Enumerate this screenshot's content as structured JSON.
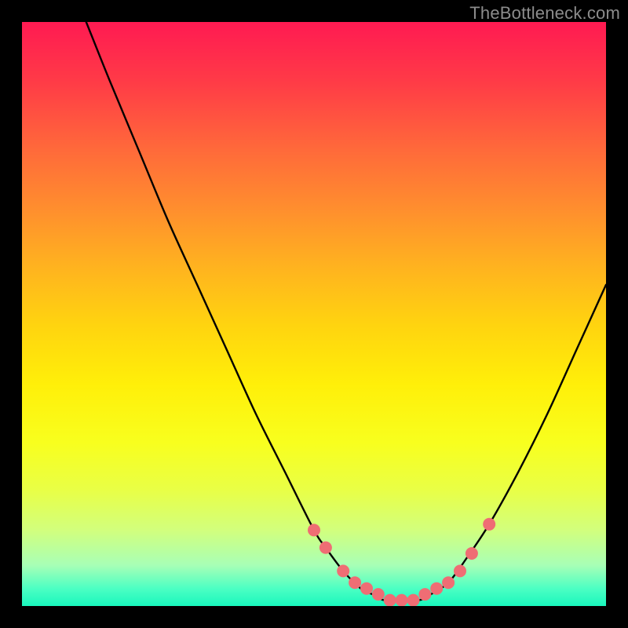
{
  "watermark": "TheBottleneck.com",
  "chart_data": {
    "type": "line",
    "title": "",
    "xlabel": "",
    "ylabel": "",
    "xlim": [
      0,
      100
    ],
    "ylim": [
      0,
      100
    ],
    "series": [
      {
        "name": "bottleneck-curve",
        "x": [
          11,
          15,
          20,
          25,
          30,
          35,
          40,
          45,
          50,
          52,
          55,
          58,
          60,
          62,
          65,
          68,
          70,
          73,
          76,
          80,
          85,
          90,
          95,
          100
        ],
        "y": [
          100,
          90,
          78,
          66,
          55,
          44,
          33,
          23,
          13,
          10,
          6,
          3,
          2,
          1,
          1,
          1,
          2,
          4,
          8,
          14,
          23,
          33,
          44,
          55
        ]
      }
    ],
    "markers": {
      "name": "highlight-dots",
      "x": [
        50,
        52,
        55,
        57,
        59,
        61,
        63,
        65,
        67,
        69,
        71,
        73,
        75,
        77,
        80
      ],
      "y": [
        13,
        10,
        6,
        4,
        3,
        2,
        1,
        1,
        1,
        2,
        3,
        4,
        6,
        9,
        14
      ]
    }
  }
}
